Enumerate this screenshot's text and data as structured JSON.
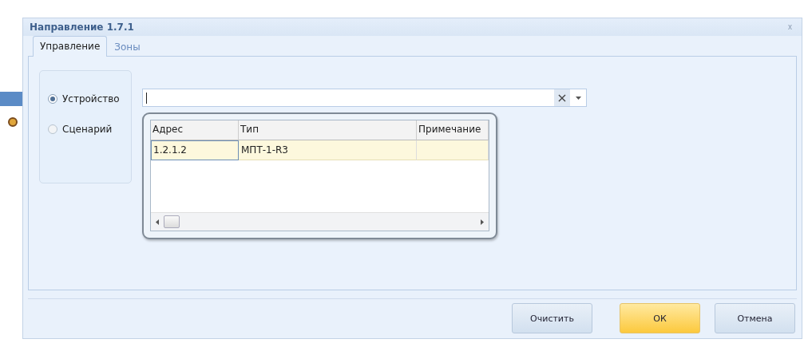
{
  "window": {
    "title": "Направление 1.7.1",
    "close": "x"
  },
  "tabs": [
    {
      "label": "Управление",
      "selected": true
    },
    {
      "label": "Зоны",
      "selected": false
    }
  ],
  "source_options": [
    {
      "label": "Устройство",
      "selected": true
    },
    {
      "label": "Сценарий",
      "selected": false
    }
  ],
  "device_field": {
    "clear": "×",
    "dropdown": {
      "open": true,
      "columns": [
        "Адрес",
        "Тип",
        "Примечание"
      ],
      "rows": [
        {
          "cells": [
            "1.2.1.2",
            "МПТ-1-R3",
            ""
          ],
          "selected": true
        }
      ]
    }
  },
  "buttons": [
    {
      "label": "Очистить",
      "kind": "normal"
    },
    {
      "label": "ОК",
      "kind": "primary"
    },
    {
      "label": "Отмена",
      "kind": "normal"
    }
  ]
}
